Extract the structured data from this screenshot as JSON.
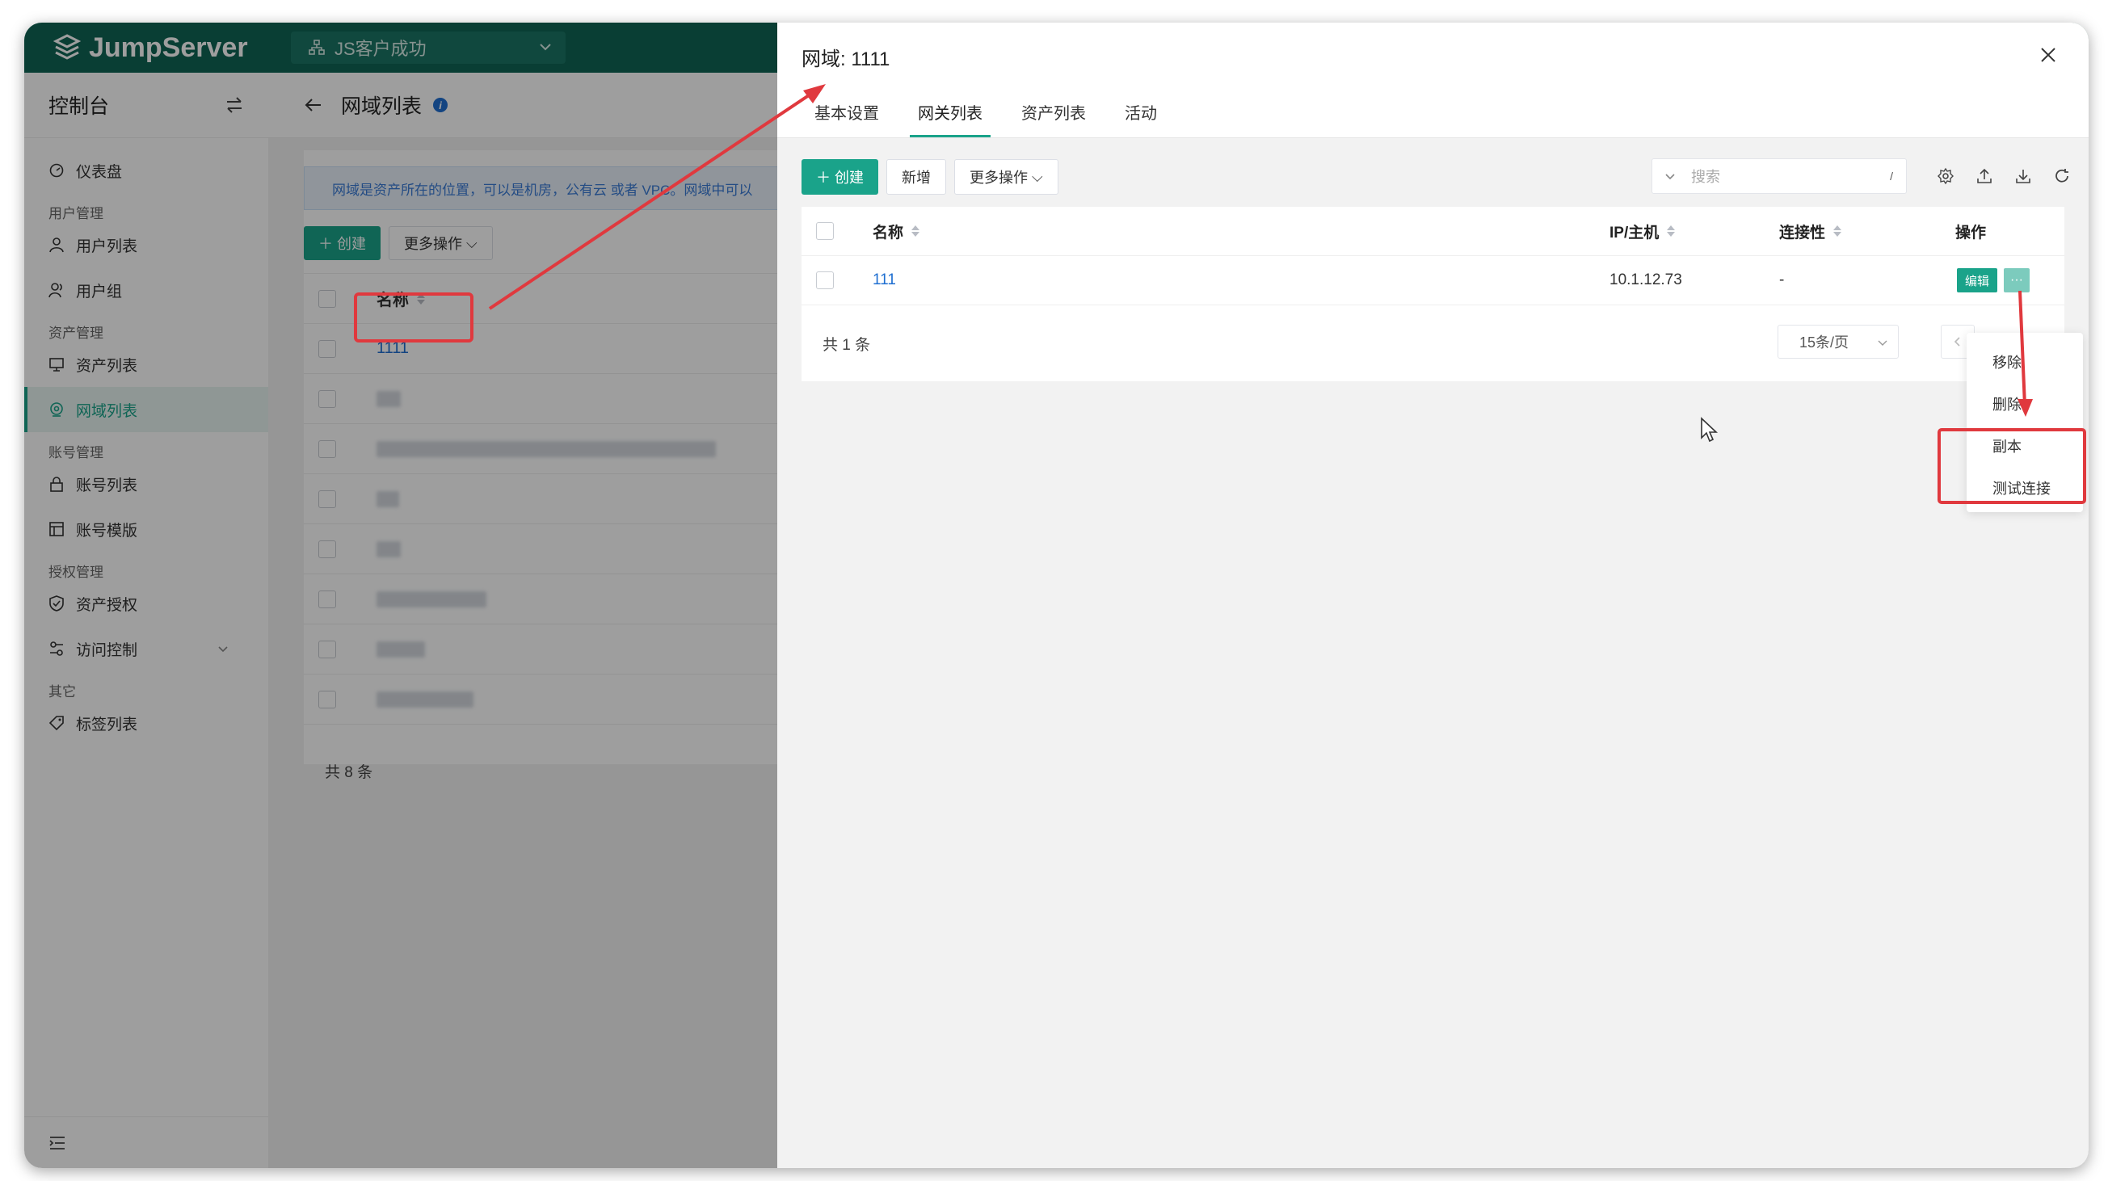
{
  "app": {
    "brand": "JumpServer",
    "org": "JS客户成功"
  },
  "sidebar": {
    "title": "控制台",
    "groups": {
      "user": "用户管理",
      "asset": "资产管理",
      "account": "账号管理",
      "perm": "授权管理",
      "other": "其它"
    },
    "items": {
      "dashboard": "仪表盘",
      "user_list": "用户列表",
      "user_group": "用户组",
      "asset_list": "资产列表",
      "domain_list": "网域列表",
      "account_list": "账号列表",
      "account_template": "账号模版",
      "asset_perm": "资产授权",
      "access_control": "访问控制",
      "label_list": "标签列表"
    }
  },
  "page": {
    "title": "网域列表",
    "alert": "网域是资产所在的位置，可以是机房，公有云 或者 VPC。网域中可以",
    "create_btn": "创建",
    "more_btn": "更多操作",
    "col_name": "名称",
    "first_row": "1111",
    "total": "共 8 条"
  },
  "drawer": {
    "title": "网域: 1111",
    "tabs": [
      "基本设置",
      "网关列表",
      "资产列表",
      "活动"
    ],
    "active_tab": "网关列表",
    "create_btn": "创建",
    "add_btn": "新增",
    "more_btn": "更多操作",
    "search_placeholder": "搜索",
    "search_shortcut": "/",
    "columns": {
      "name": "名称",
      "ip": "IP/主机",
      "conn": "连接性",
      "action": "操作"
    },
    "rows": [
      {
        "name": "111",
        "ip": "10.1.12.73",
        "conn": "-"
      }
    ],
    "edit_btn": "编辑",
    "more_icon_label": "···",
    "total": "共 1 条",
    "page_size": "15条/页",
    "dropdown": [
      "移除",
      "删除",
      "副本",
      "测试连接"
    ]
  },
  "colors": {
    "brand": "#0f6554",
    "accent": "#1aa38a",
    "annotation": "#e0393e"
  }
}
